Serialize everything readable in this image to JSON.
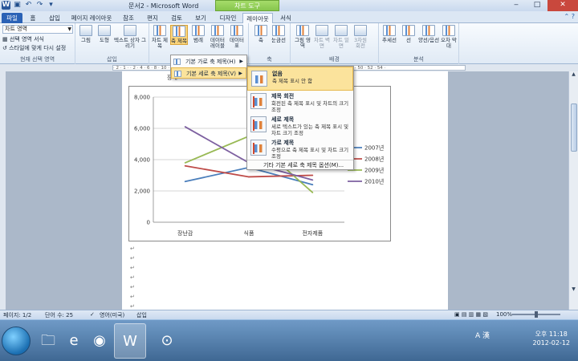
{
  "title_bar": {
    "title": "문서2 - Microsoft Word",
    "context_tab": "차트 도구",
    "window_buttons": [
      "‒",
      "□",
      "✕"
    ]
  },
  "tabs": [
    {
      "label": "파일",
      "type": "file"
    },
    {
      "label": "홈"
    },
    {
      "label": "삽입"
    },
    {
      "label": "페이지 레이아웃"
    },
    {
      "label": "참조"
    },
    {
      "label": "편지"
    },
    {
      "label": "검토"
    },
    {
      "label": "보기"
    },
    {
      "label": "디자인"
    },
    {
      "label": "레이아웃",
      "active": true
    },
    {
      "label": "서식"
    }
  ],
  "ribbon": {
    "current_selection": {
      "dropdown_value": "차트 영역",
      "format_selection": "선택 영역 서식",
      "reset_style": "스타일에 맞게 다시 설정",
      "group_label": "현재 선택 영역"
    },
    "insert_group": {
      "label": "삽입",
      "buttons": [
        "그림",
        "도형",
        "텍스트 상자 그리기"
      ]
    },
    "labels_group": {
      "buttons": [
        "차트 제목",
        "축 제목",
        "범례",
        "데이터 레이블",
        "데이터 표"
      ]
    },
    "axes_group": {
      "label": "축",
      "buttons": [
        "축",
        "눈금선"
      ]
    },
    "background_group": {
      "label": "배경",
      "buttons": [
        "그림 영역",
        "차트 벽면",
        "차트 밑면",
        "3차원 회전"
      ]
    },
    "analysis_group": {
      "label": "분석",
      "buttons": [
        "추세선",
        "선",
        "양선/음선",
        "오차 막대"
      ]
    }
  },
  "menu": {
    "items": [
      {
        "label": "기본 가로 축 제목(H)",
        "highlighted": false
      },
      {
        "label": "기본 세로 축 제목(V)",
        "highlighted": true
      }
    ]
  },
  "submenu": {
    "items": [
      {
        "title": "없음",
        "desc": "축 제목 표시 안 함",
        "selected": true
      },
      {
        "title": "제목 회전",
        "desc": "회전된 축 제목 표시 및 차트의 크기 조정",
        "selected": false
      },
      {
        "title": "세로 제목",
        "desc": "세로 텍스트가 있는 축 제목 표시 및 차트 크기 조정",
        "selected": false
      },
      {
        "title": "가로 제목",
        "desc": "수평으로 축 제목 표시 및 차트 크기 조정",
        "selected": false
      }
    ],
    "more_options": "기타 기본 세로 축 제목 옵션(M)..."
  },
  "document": {
    "hidden_text": "장내",
    "colors": {
      "page": "#ffffff",
      "doc_bg": "#abb8c9"
    }
  },
  "chart_data": {
    "type": "line",
    "categories": [
      "장난감",
      "식품",
      "전자제품"
    ],
    "ylim": [
      0,
      8000
    ],
    "y_ticks": [
      "0",
      "2,000",
      "4,000",
      "6,000",
      "8,000"
    ],
    "grid": true,
    "legend_placement": "right",
    "series": [
      {
        "name": "2007년",
        "values": [
          2600,
          3500,
          2400
        ],
        "color": "#4a7ebb"
      },
      {
        "name": "2008년",
        "values": [
          3600,
          2900,
          3000
        ],
        "color": "#be4b48"
      },
      {
        "name": "2009년",
        "values": [
          3800,
          5500,
          1900
        ],
        "color": "#98b954"
      },
      {
        "name": "2010년",
        "values": [
          6100,
          3800,
          2700
        ],
        "color": "#7d60a0"
      }
    ]
  },
  "status_bar": {
    "page": "페이지: 1/2",
    "words": "단어 수: 25",
    "language": "영어(미국)",
    "mode": "삽입",
    "zoom": "100%"
  },
  "taskbar": {
    "apps": [
      "explorer-icon",
      "ie-icon",
      "firefox-icon",
      "word-icon",
      "search-app-icon"
    ],
    "ime": "A 漢",
    "time": "오후 11:18",
    "date": "2012-02-12"
  }
}
